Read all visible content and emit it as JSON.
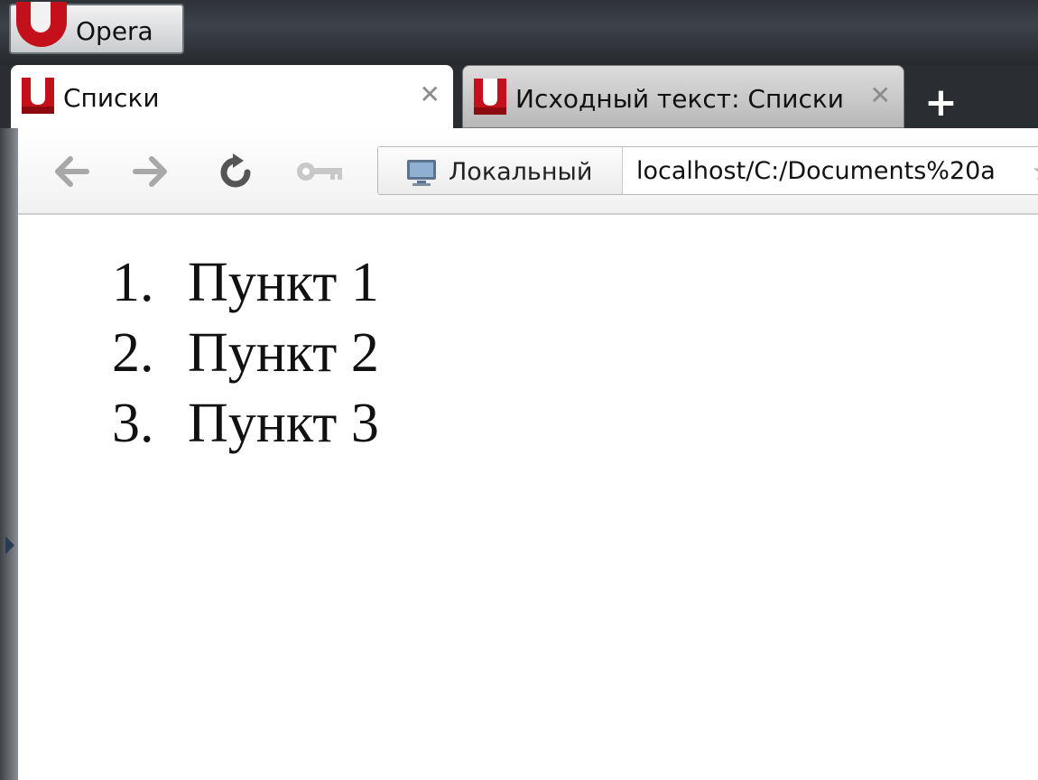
{
  "window": {
    "menu_button_label": "Opera"
  },
  "tabs": [
    {
      "title": "Списки",
      "active": true
    },
    {
      "title": "Исходный текст: Списки",
      "active": false
    }
  ],
  "new_tab_label": "+",
  "toolbar": {
    "back_icon": "back-arrow-icon",
    "forward_icon": "forward-arrow-icon",
    "reload_icon": "reload-icon",
    "key_icon": "key-icon"
  },
  "address_bar": {
    "security_badge_label": "Локальный",
    "security_badge_icon": "computer-icon",
    "url_value": "localhost/C:/Documents%20a"
  },
  "page": {
    "list_items": [
      {
        "marker": "1.",
        "text": "Пункт 1"
      },
      {
        "marker": "2.",
        "text": "Пункт 2"
      },
      {
        "marker": "3.",
        "text": "Пункт 3"
      }
    ]
  },
  "colors": {
    "opera_red": "#c4101a",
    "chrome_dark": "#2a2d31",
    "page_background": "#ffffff"
  }
}
